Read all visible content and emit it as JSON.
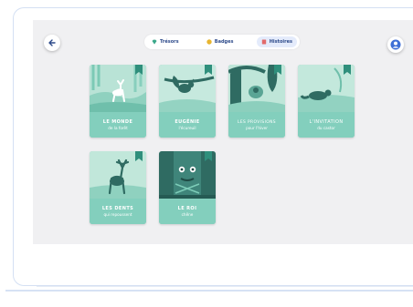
{
  "tabs": [
    {
      "label": "Trésors",
      "icon": "gem-icon",
      "color": "#3aa88a"
    },
    {
      "label": "Badges",
      "icon": "badge-icon",
      "color": "#e8b530"
    },
    {
      "label": "Histoires",
      "icon": "book-icon",
      "color": "#e26a6a"
    }
  ],
  "stories": [
    {
      "title": "LE MONDE",
      "subtitle": "de la forêt"
    },
    {
      "title": "EUGÉNIE",
      "subtitle": "l'écureuil"
    },
    {
      "title": "LES PROVISIONS",
      "subtitle": "pour l'hiver"
    },
    {
      "title": "L'INVITATION",
      "subtitle": "du castor"
    },
    {
      "title": "LES DENTS",
      "subtitle": "qui repoussent"
    },
    {
      "title": "LE ROI",
      "subtitle": "chêne"
    }
  ],
  "colors": {
    "card": "#7dccb8",
    "card_dark": "#2f6b62",
    "accent": "#3f6fd6"
  }
}
